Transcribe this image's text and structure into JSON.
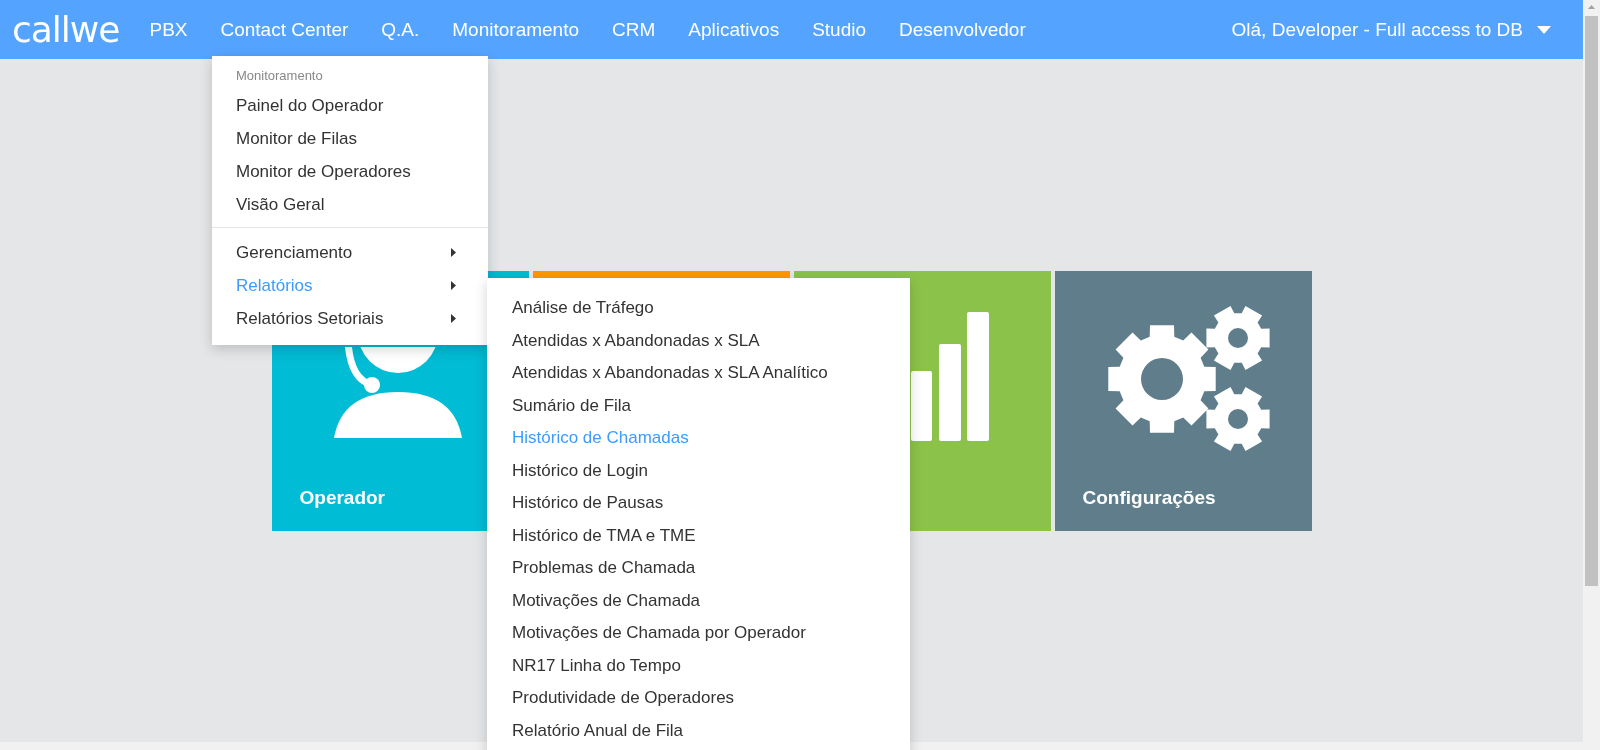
{
  "navbar": {
    "logo": "callwe",
    "items": [
      "PBX",
      "Contact Center",
      "Q.A.",
      "Monitoramento",
      "CRM",
      "Aplicativos",
      "Studio",
      "Desenvolvedor"
    ],
    "user": "Olá, Developer - Full access to DB"
  },
  "tiles": [
    {
      "label": "Operador",
      "color": "#00bcd4",
      "kind": "headset"
    },
    {
      "color": "#ff9800",
      "kind": "blank"
    },
    {
      "color": "#8bc34a",
      "kind": "chart"
    },
    {
      "label": "Configurações",
      "color": "#607d8b",
      "kind": "gears"
    }
  ],
  "dropdown": {
    "header": "Monitoramento",
    "sections": [
      [
        {
          "label": "Painel do Operador",
          "kind": "link",
          "selected": false
        },
        {
          "label": "Monitor de Filas",
          "kind": "link",
          "selected": false
        },
        {
          "label": "Monitor de Operadores",
          "kind": "link",
          "selected": false
        },
        {
          "label": "Visão Geral",
          "kind": "link",
          "selected": false
        }
      ],
      [
        {
          "label": "Gerenciamento",
          "kind": "submenu",
          "selected": false
        },
        {
          "label": "Relatórios",
          "kind": "submenu",
          "selected": true
        },
        {
          "label": "Relatórios Setoriais",
          "kind": "submenu",
          "selected": false
        }
      ]
    ]
  },
  "submenu": {
    "items": [
      {
        "label": "Análise de Tráfego",
        "selected": false
      },
      {
        "label": "Atendidas x Abandonadas x SLA",
        "selected": false
      },
      {
        "label": "Atendidas x Abandonadas x SLA Analítico",
        "selected": false
      },
      {
        "label": "Sumário de Fila",
        "selected": false
      },
      {
        "label": "Histórico de Chamadas",
        "selected": true
      },
      {
        "label": "Histórico de Login",
        "selected": false
      },
      {
        "label": "Histórico de Pausas",
        "selected": false
      },
      {
        "label": "Histórico de TMA e TME",
        "selected": false
      },
      {
        "label": "Problemas de Chamada",
        "selected": false
      },
      {
        "label": "Motivações de Chamada",
        "selected": false
      },
      {
        "label": "Motivações de Chamada por Operador",
        "selected": false
      },
      {
        "label": "NR17 Linha do Tempo",
        "selected": false
      },
      {
        "label": "Produtividade de Operadores",
        "selected": false
      },
      {
        "label": "Relatório Anual de Fila",
        "selected": false
      }
    ]
  }
}
